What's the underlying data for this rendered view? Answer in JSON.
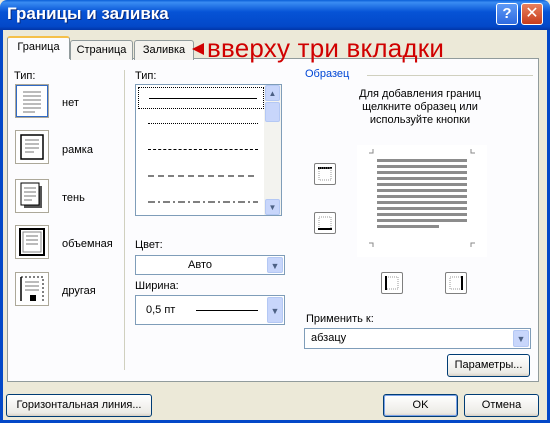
{
  "window": {
    "title": "Границы и заливка",
    "help_label": "?",
    "close_label": "✕"
  },
  "tabs": [
    {
      "label": "Граница",
      "active": true
    },
    {
      "label": "Страница",
      "active": false
    },
    {
      "label": "Заливка",
      "active": false
    }
  ],
  "annotation": {
    "text": "вверху три вкладки",
    "color": "#d00000"
  },
  "type_presets": {
    "label": "Тип:",
    "items": [
      {
        "label": "нет",
        "icon": "border-none-icon",
        "selected": true
      },
      {
        "label": "рамка",
        "icon": "border-box-icon",
        "selected": false
      },
      {
        "label": "тень",
        "icon": "border-shadow-icon",
        "selected": false
      },
      {
        "label": "объемная",
        "icon": "border-3d-icon",
        "selected": false
      },
      {
        "label": "другая",
        "icon": "border-custom-icon",
        "selected": false
      }
    ]
  },
  "line_style": {
    "label": "Тип:",
    "styles": [
      "solid",
      "dotted",
      "dashed-small",
      "dashed",
      "dash-dot"
    ]
  },
  "color": {
    "label": "Цвет:",
    "value": "Авто"
  },
  "width": {
    "label": "Ширина:",
    "value": "0,5 пт"
  },
  "sample": {
    "label": "Образец",
    "hint": [
      "Для добавления границ",
      "щелкните образец или",
      "используйте кнопки"
    ]
  },
  "apply_to": {
    "label": "Применить к:",
    "value": "абзацу"
  },
  "buttons": {
    "options": "Параметры...",
    "horizontal_line": "Горизонтальная линия...",
    "ok": "OK",
    "cancel": "Отмена"
  },
  "colors": {
    "titlebar": "#0348c8",
    "dialog_bg": "#ece9d8",
    "tab_highlight": "#f5c04a",
    "sample_label": "#0046d5"
  }
}
